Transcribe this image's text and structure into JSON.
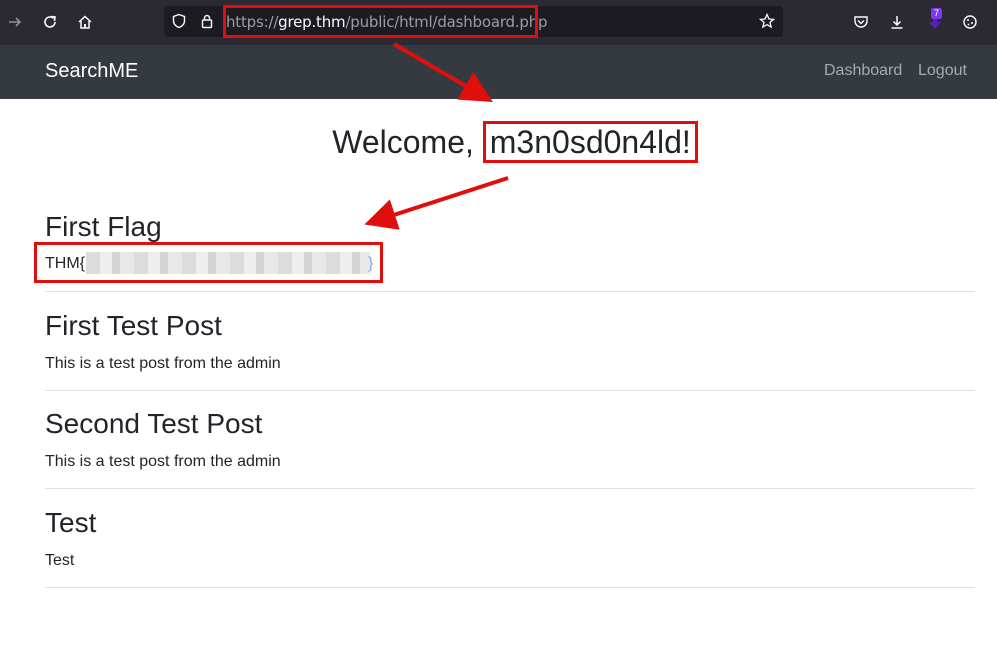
{
  "browser": {
    "url_scheme": "https://",
    "url_host": "grep.thm",
    "url_path": "/public/html/dashboard.php",
    "extension_badge": "7"
  },
  "navbar": {
    "brand": "SearchME",
    "links": [
      "Dashboard",
      "Logout"
    ]
  },
  "welcome": {
    "prefix": "Welcome, ",
    "username": "m3n0sd0n4ld!"
  },
  "flag": {
    "title": "First Flag",
    "prefix": "THM{",
    "suffix": "}"
  },
  "posts": [
    {
      "title": "First Test Post",
      "body": "This is a test post from the admin"
    },
    {
      "title": "Second Test Post",
      "body": "This is a test post from the admin"
    },
    {
      "title": "Test",
      "body": "Test"
    }
  ],
  "colors": {
    "annotation": "#e10e0e",
    "navbar": "#343a40",
    "browser_chrome": "#2b2a33"
  }
}
